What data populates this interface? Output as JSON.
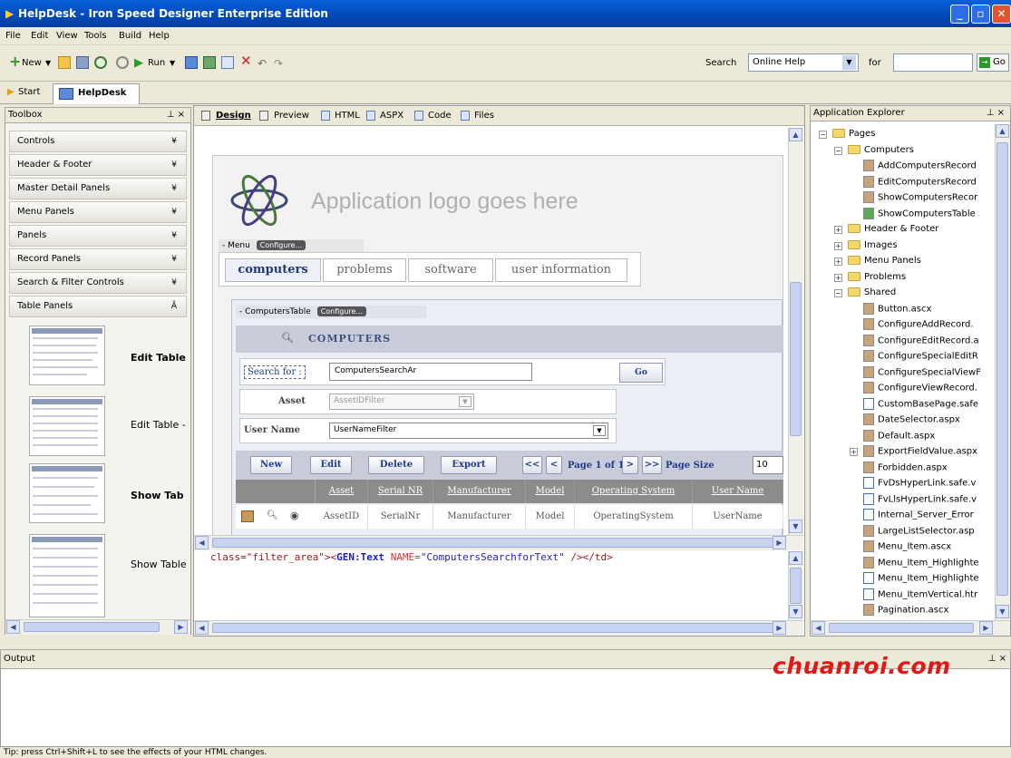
{
  "window": {
    "title": "HelpDesk - Iron Speed Designer Enterprise Edition"
  },
  "menu": [
    "File",
    "Edit",
    "View",
    "Tools",
    "Build",
    "Help"
  ],
  "toolbar": {
    "new_label": "New",
    "run_label": "Run",
    "search_label": "Search",
    "search_scope": "Online Help",
    "for_label": "for",
    "go_label": "Go"
  },
  "doctabs": {
    "start": "Start",
    "helpdesk": "HelpDesk"
  },
  "toolbox": {
    "title": "Toolbox",
    "groups": [
      "Controls",
      "Header & Footer",
      "Master Detail Panels",
      "Menu Panels",
      "Panels",
      "Record Panels",
      "Search & Filter Controls",
      "Table Panels"
    ],
    "items": [
      "Edit Table",
      "Edit Table -",
      "Show Tab",
      "Show Table"
    ]
  },
  "designer": {
    "tabs": [
      "Design",
      "Preview",
      "HTML",
      "ASPX",
      "Code",
      "Files"
    ],
    "logo_text": "Application logo goes here",
    "menu_label": "- Menu",
    "configure_label": "Configure...",
    "menu_tabs": [
      "computers",
      "problems",
      "software",
      "user information"
    ],
    "table_label": "- ComputersTable",
    "table_title": "COMPUTERS",
    "search_for_label": "Search for :",
    "search_value": "ComputersSearchAr",
    "go_label": "Go",
    "asset_label": "Asset",
    "asset_value": "AssetIDFilter",
    "username_label": "User Name",
    "username_value": "UserNameFilter",
    "buttons": [
      "New",
      "Edit",
      "Delete",
      "Export"
    ],
    "page_prev": "<<",
    "page_back": "<",
    "page_text": "Page 1 of 1",
    "page_next": ">",
    "page_last": ">>",
    "page_size_label": "Page Size",
    "page_size_value": "10",
    "columns": [
      "Asset",
      "Serial NR",
      "Manufacturer",
      "Model",
      "Operating System",
      "User Name"
    ],
    "row": [
      "AssetID",
      "SerialNr",
      "Manufacturer",
      "Model",
      "OperatingSystem",
      "UserName"
    ],
    "code_prefix": "class=\"filter_area\"><",
    "code_tag": "GEN:Text",
    "code_attr": "NAME=",
    "code_value": "\"ComputersSearchforText\"",
    "code_suffix": " /></td>"
  },
  "explorer": {
    "title": "Application Explorer",
    "items": [
      "Pages",
      "Computers",
      "AddComputersRecord",
      "EditComputersRecord",
      "ShowComputersRecor",
      "ShowComputersTable",
      "Header & Footer",
      "Images",
      "Menu Panels",
      "Problems",
      "Shared",
      "Button.ascx",
      "ConfigureAddRecord.",
      "ConfigureEditRecord.a",
      "ConfigureSpecialEditR",
      "ConfigureSpecialViewF",
      "ConfigureViewRecord.",
      "CustomBasePage.safe",
      "DateSelector.aspx",
      "Default.aspx",
      "ExportFieldValue.aspx",
      "Forbidden.aspx",
      "FvDsHyperLink.safe.v",
      "FvLlsHyperLink.safe.v",
      "Internal_Server_Error",
      "LargeListSelector.asp",
      "Menu_Item.ascx",
      "Menu_Item_Highlighte",
      "Menu_Item_Highlighte",
      "Menu_ItemVertical.htr",
      "Pagination.ascx"
    ]
  },
  "output": {
    "title": "Output"
  },
  "status": "Tip: press Ctrl+Shift+L to see the effects of your HTML changes.",
  "watermark": "chuanroi.com"
}
